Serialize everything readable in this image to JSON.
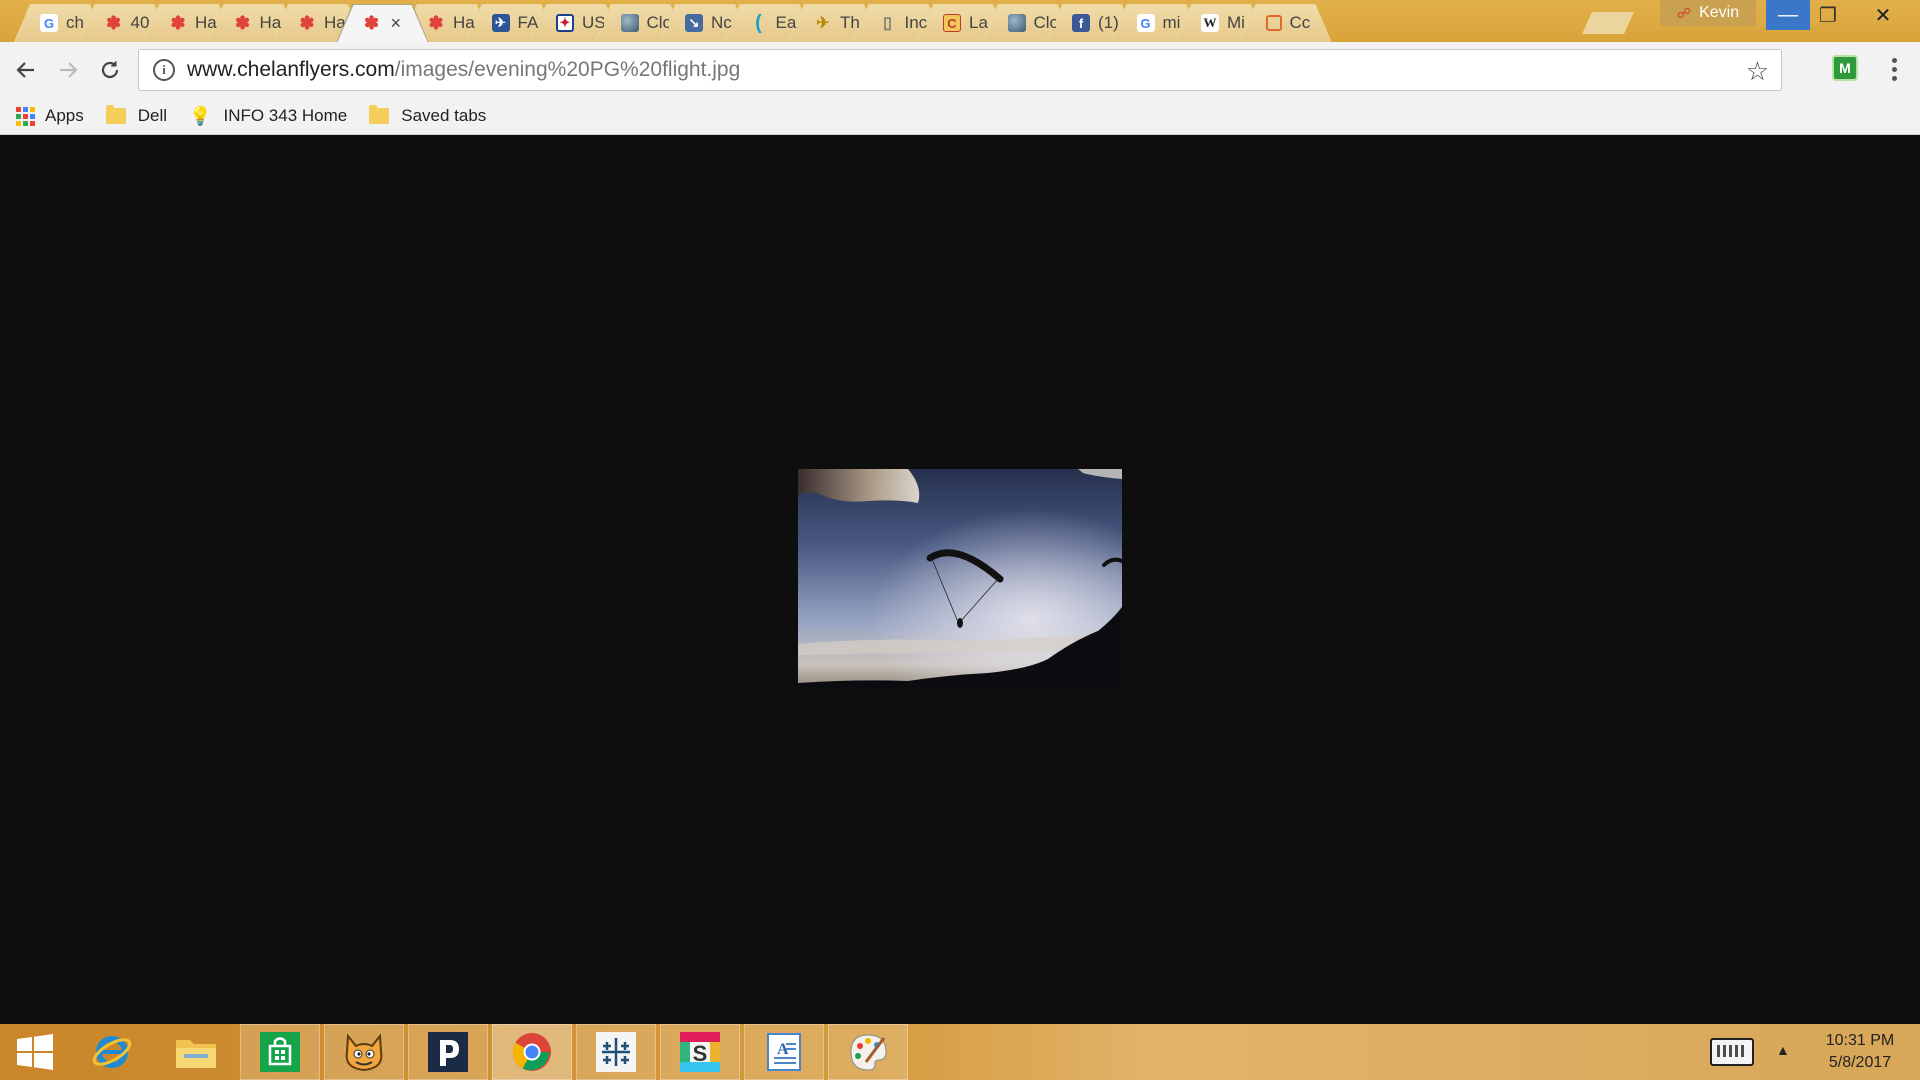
{
  "tabs": [
    {
      "label": "ch",
      "icon": "google-icon",
      "glyph": "G",
      "cls": "fav-g"
    },
    {
      "label": "40",
      "icon": "flower-icon",
      "glyph": "✽",
      "cls": "fav-flower"
    },
    {
      "label": "Ha",
      "icon": "flower-icon",
      "glyph": "✽",
      "cls": "fav-flower"
    },
    {
      "label": "Ha",
      "icon": "flower-icon",
      "glyph": "✽",
      "cls": "fav-flower"
    },
    {
      "label": "Ha",
      "icon": "flower-icon",
      "glyph": "✽",
      "cls": "fav-flower"
    },
    {
      "label": "",
      "icon": "flower-icon",
      "glyph": "✽",
      "cls": "fav-flower",
      "active": true
    },
    {
      "label": "Ha",
      "icon": "flower-icon",
      "glyph": "✽",
      "cls": "fav-flower"
    },
    {
      "label": "FA",
      "icon": "faa-icon",
      "glyph": "✈",
      "cls": "fav-fa"
    },
    {
      "label": "US",
      "icon": "us-icon",
      "glyph": "✦",
      "cls": "fav-us"
    },
    {
      "label": "Clo",
      "icon": "globe-icon",
      "glyph": "",
      "cls": "fav-globe"
    },
    {
      "label": "Nc",
      "icon": "noaa-icon",
      "glyph": "↘",
      "cls": "fav-nc"
    },
    {
      "label": "Ea",
      "icon": "wave-icon",
      "glyph": "(",
      "cls": "fav-ea"
    },
    {
      "label": "Th",
      "icon": "paraglider-icon",
      "glyph": "✈",
      "cls": "fav-th"
    },
    {
      "label": "Inc",
      "icon": "document-icon",
      "glyph": "▯",
      "cls": "fav-doc"
    },
    {
      "label": "La",
      "icon": "letter-c-icon",
      "glyph": "C",
      "cls": "fav-la"
    },
    {
      "label": "Clo",
      "icon": "globe-icon",
      "glyph": "",
      "cls": "fav-globe"
    },
    {
      "label": "(1)",
      "icon": "facebook-icon",
      "glyph": "f",
      "cls": "fav-fb"
    },
    {
      "label": "mi",
      "icon": "google-icon",
      "glyph": "G",
      "cls": "fav-g"
    },
    {
      "label": "Mi",
      "icon": "wikipedia-icon",
      "glyph": "W",
      "cls": "fav-w"
    },
    {
      "label": "Cc",
      "icon": "planet-icon",
      "glyph": "",
      "cls": "fav-cc"
    }
  ],
  "active_tab_close": "×",
  "profile": {
    "name": "Kevin"
  },
  "window_controls": {
    "minimize": "—",
    "maximize": "❐",
    "close": "✕"
  },
  "toolbar": {
    "back": "←",
    "forward": "→",
    "reload": "↻",
    "info": "i",
    "url_domain": "www.chelanflyers.com",
    "url_path": "/images/evening%20PG%20flight.jpg",
    "star": "☆",
    "extension": "M"
  },
  "bookmarks": [
    {
      "label": "Apps",
      "icon": "apps-grid-icon"
    },
    {
      "label": "Dell",
      "icon": "folder-icon"
    },
    {
      "label": "INFO 343 Home",
      "icon": "lightbulb-icon"
    },
    {
      "label": "Saved tabs",
      "icon": "folder-icon"
    }
  ],
  "colors": {
    "tabstrip": "#d9a33a",
    "content_bg": "#0e0e0e",
    "minimize_btn": "#3b77c8"
  },
  "taskbar": {
    "items": [
      {
        "name": "start-button",
        "icon": "windows-logo-icon"
      },
      {
        "name": "internet-explorer-button",
        "icon": "internet-explorer-icon"
      },
      {
        "name": "file-explorer-button",
        "icon": "folder-icon"
      },
      {
        "name": "store-button",
        "icon": "store-icon"
      },
      {
        "name": "scratch-button",
        "icon": "cat-icon"
      },
      {
        "name": "pandora-button",
        "icon": "pandora-icon"
      },
      {
        "name": "chrome-button",
        "icon": "chrome-icon"
      },
      {
        "name": "tableau-button",
        "icon": "tableau-icon"
      },
      {
        "name": "slack-button",
        "icon": "slack-icon"
      },
      {
        "name": "wordpad-button",
        "icon": "wordpad-icon"
      },
      {
        "name": "paint-button",
        "icon": "palette-icon"
      }
    ],
    "clock_time": "10:31 PM",
    "clock_date": "5/8/2017",
    "tray_arrow": "▲"
  }
}
